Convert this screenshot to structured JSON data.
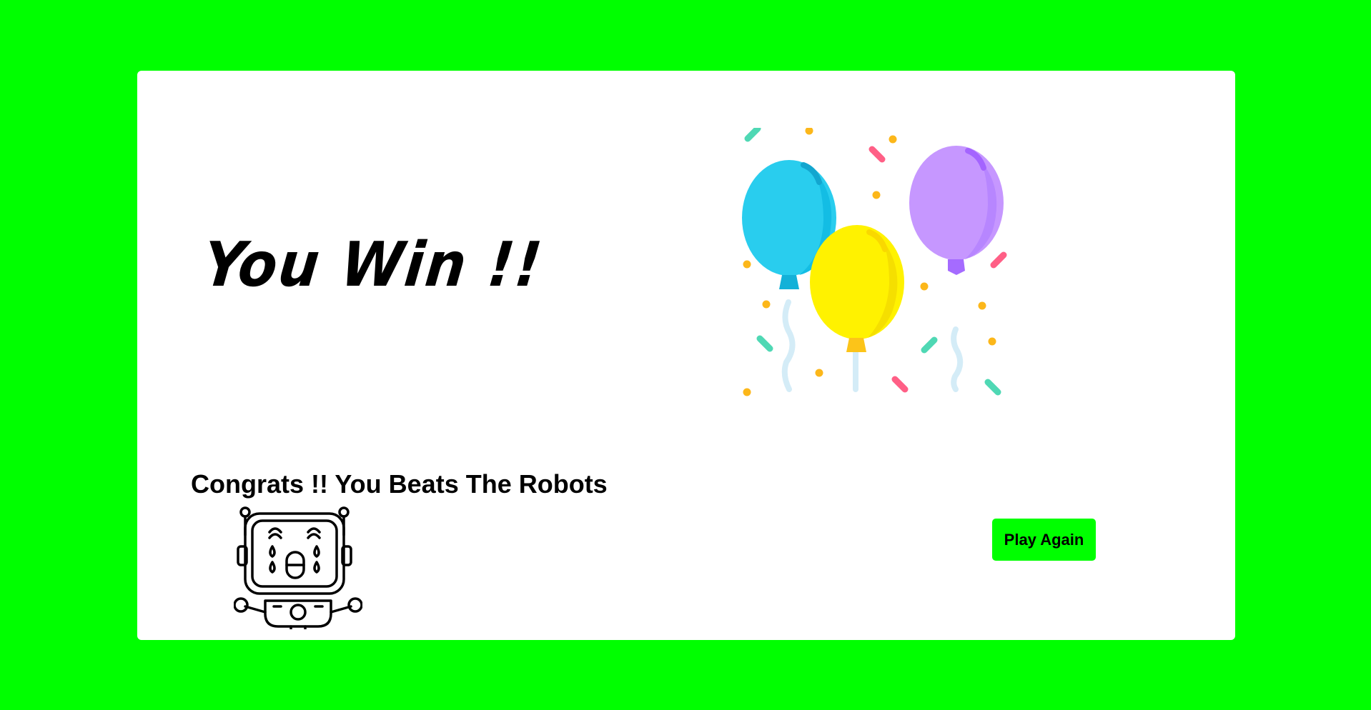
{
  "result": {
    "headline": "You Win !!",
    "message": "Congrats !! You Beats The Robots"
  },
  "actions": {
    "play_again_label": "Play Again"
  },
  "colors": {
    "background": "#00ff00",
    "card": "#ffffff",
    "button": "#00ff00",
    "balloon_blue": "#29cdee",
    "balloon_yellow": "#fff200",
    "balloon_purple": "#c697ff",
    "confetti_green": "#4fd8b4",
    "confetti_pink": "#ff5f86",
    "confetti_dot": "#fcb71a",
    "string": "#d4ecf7"
  },
  "icons": {
    "celebration": "balloons-confetti-icon",
    "robot": "crying-robot-icon"
  }
}
